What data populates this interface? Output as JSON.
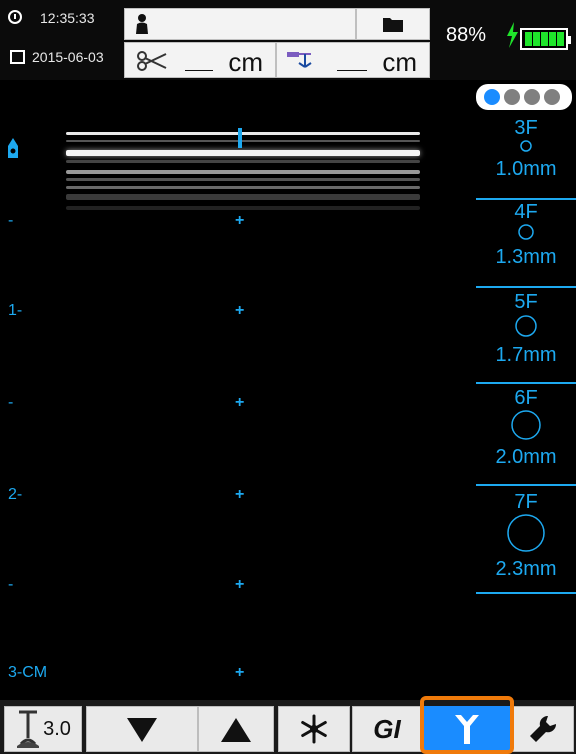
{
  "status": {
    "time": "12:35:33",
    "date": "2015-06-03",
    "battery_percent": "88%",
    "battery_level": 1.0
  },
  "measurements": {
    "unit1": "cm",
    "unit2": "cm"
  },
  "depth_ruler": {
    "labels": [
      "-",
      "1-",
      "-",
      "2-",
      "-",
      "3-CM"
    ]
  },
  "gauges": [
    {
      "size": "3F",
      "diameter": "1.0mm"
    },
    {
      "size": "4F",
      "diameter": "1.3mm"
    },
    {
      "size": "5F",
      "diameter": "1.7mm"
    },
    {
      "size": "6F",
      "diameter": "2.0mm"
    },
    {
      "size": "7F",
      "diameter": "2.3mm"
    }
  ],
  "toolbar": {
    "frequency": "3.0",
    "gi_label": "GI"
  },
  "colors": {
    "accent": "#1da9f0",
    "active_button": "#1a8cff",
    "highlight": "#f07a0a",
    "battery": "#1fe52b"
  }
}
